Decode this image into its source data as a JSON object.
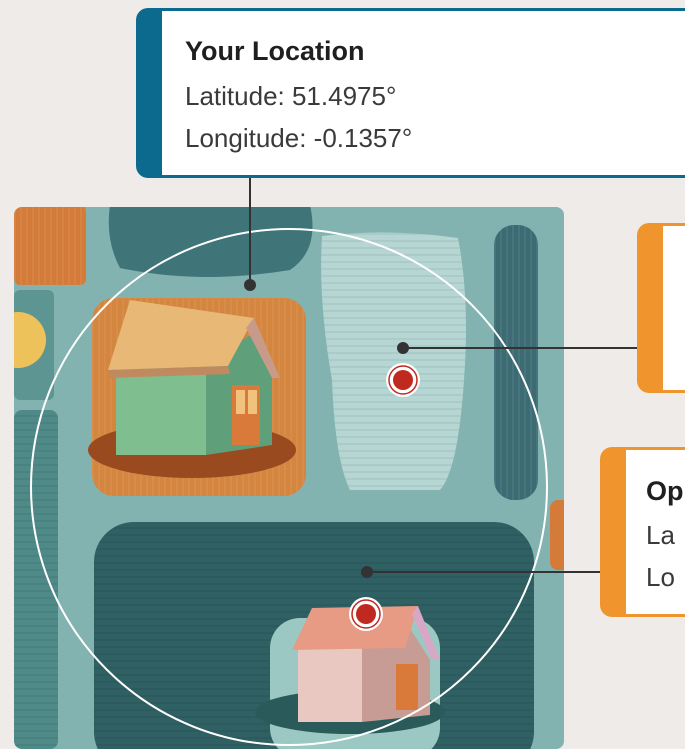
{
  "location_card": {
    "title": "Your Location",
    "latitude_line": "Latitude: 51.4975°",
    "longitude_line": "Longitude: -0.1357°",
    "accent_color": "#0d6a8f"
  },
  "option_card_top": {
    "accent_color": "#f0952e"
  },
  "option_card_bottom": {
    "title": "Op",
    "latitude_line": "La",
    "longitude_line": "Lo",
    "accent_color": "#f0952e"
  },
  "map": {
    "icons": [
      "house-icon",
      "map-pin-icon"
    ],
    "pin_color": "#c0291f",
    "background_color": "#7fb0ad"
  }
}
